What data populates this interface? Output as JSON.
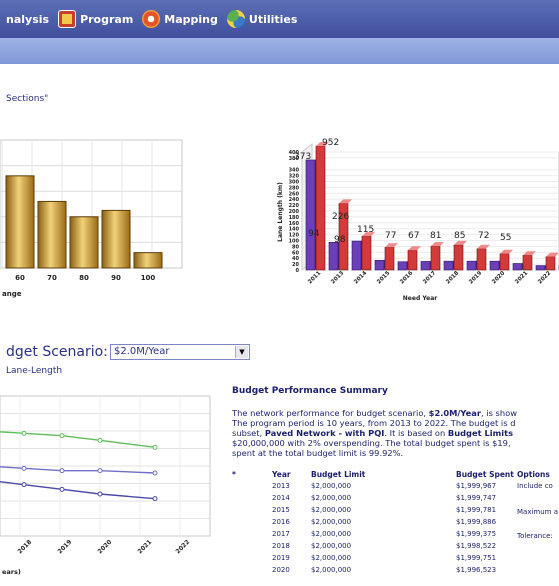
{
  "toolbar": {
    "items": [
      {
        "label": "nalysis",
        "icon": ""
      },
      {
        "label": "Program",
        "icon": "program-icon"
      },
      {
        "label": "Mapping",
        "icon": "mapping-icon"
      },
      {
        "label": "Utilities",
        "icon": "utilities-icon"
      }
    ]
  },
  "selection_text": "Sections\"",
  "scenario": {
    "label": "dget Scenario:",
    "selected": "$2.0M/Year",
    "sublabel": "Lane-Length"
  },
  "chart_data": [
    {
      "type": "bar",
      "categories": [
        "60",
        "70",
        "80",
        "90",
        "100"
      ],
      "values": [
        72,
        52,
        40,
        45,
        12
      ],
      "xlabel": "ange",
      "color": "#d4a53a"
    },
    {
      "type": "bar",
      "categories": [
        "2011",
        "2013",
        "2014",
        "2015",
        "2016",
        "2017",
        "2018",
        "2019",
        "2020",
        "2021",
        "2022",
        "2023"
      ],
      "series": [
        {
          "values": [
            373,
            94,
            98,
            33,
            28,
            29,
            30,
            30,
            30,
            22,
            15,
            15
          ],
          "color": "#6a3fb8"
        },
        {
          "values": [
            952,
            226,
            115,
            77,
            67,
            81,
            85,
            72,
            55,
            50,
            45,
            45
          ],
          "color": "#d43a3a"
        }
      ],
      "data_labels": [
        "373",
        "952",
        "226",
        "94",
        "98",
        "115",
        "77",
        "67",
        "81",
        "85",
        "72",
        "55"
      ],
      "yticks": [
        "400",
        "380",
        "340",
        "320",
        "300",
        "280",
        "260",
        "240",
        "220",
        "200",
        "180",
        "160",
        "140",
        "120",
        "100",
        "80",
        "60",
        "40",
        "20",
        "0"
      ],
      "ylim": [
        0,
        400
      ],
      "ylabel": "Lane Length (km)",
      "xlabel": "Need Year"
    },
    {
      "type": "line",
      "x": [
        "2018",
        "2019",
        "2020",
        "2021",
        "2022"
      ],
      "series": [
        {
          "values": [
            85,
            84,
            83,
            81,
            78
          ],
          "color": "#5fbf5a"
        },
        {
          "values": [
            70,
            69,
            68,
            68,
            67
          ],
          "color": "#6f6fc9"
        },
        {
          "values": [
            64,
            62,
            60,
            58,
            56
          ],
          "color": "#4a4aa8"
        }
      ],
      "xlabel": "ears)",
      "ylim": [
        40,
        100
      ],
      "grid": true
    }
  ],
  "summary": {
    "title": "Budget Performance Summary",
    "line1_pre": "The network performance for budget scenario, ",
    "line1_bold": "$2.0M/Year",
    "line1_post": ", is show",
    "line2": "The program period is 10 years, from 2013 to 2022. The budget is d",
    "line3_pre": "subset, ",
    "line3_bold": "Paved Network - with PQI",
    "line3_mid": ". It is based on ",
    "line3_bold2": "Budget Limits",
    "line4": "$20,000,000 with 2% overspending. The total budget spent is $19,",
    "line5": "spent at the total budget limit is 99.92%."
  },
  "budget_table": {
    "headers": {
      "star": "*",
      "year": "Year",
      "limit": "Budget Limit",
      "spent": "Budget Spent",
      "options": "Options"
    },
    "rows": [
      {
        "year": "2013",
        "limit": "$2,000,000",
        "spent": "$1,999,967"
      },
      {
        "year": "2014",
        "limit": "$2,000,000",
        "spent": "$1,999,747"
      },
      {
        "year": "2015",
        "limit": "$2,000,000",
        "spent": "$1,999,781"
      },
      {
        "year": "2016",
        "limit": "$2,000,000",
        "spent": "$1,999,886"
      },
      {
        "year": "2017",
        "limit": "$2,000,000",
        "spent": "$1,999,375"
      },
      {
        "year": "2018",
        "limit": "$2,000,000",
        "spent": "$1,998,522"
      },
      {
        "year": "2019",
        "limit": "$2,000,000",
        "spent": "$1,999,751"
      },
      {
        "year": "2020",
        "limit": "$2,000,000",
        "spent": "$1,996,523"
      }
    ],
    "options": [
      "Include co",
      "Maximum a",
      "Tolerance:"
    ]
  }
}
